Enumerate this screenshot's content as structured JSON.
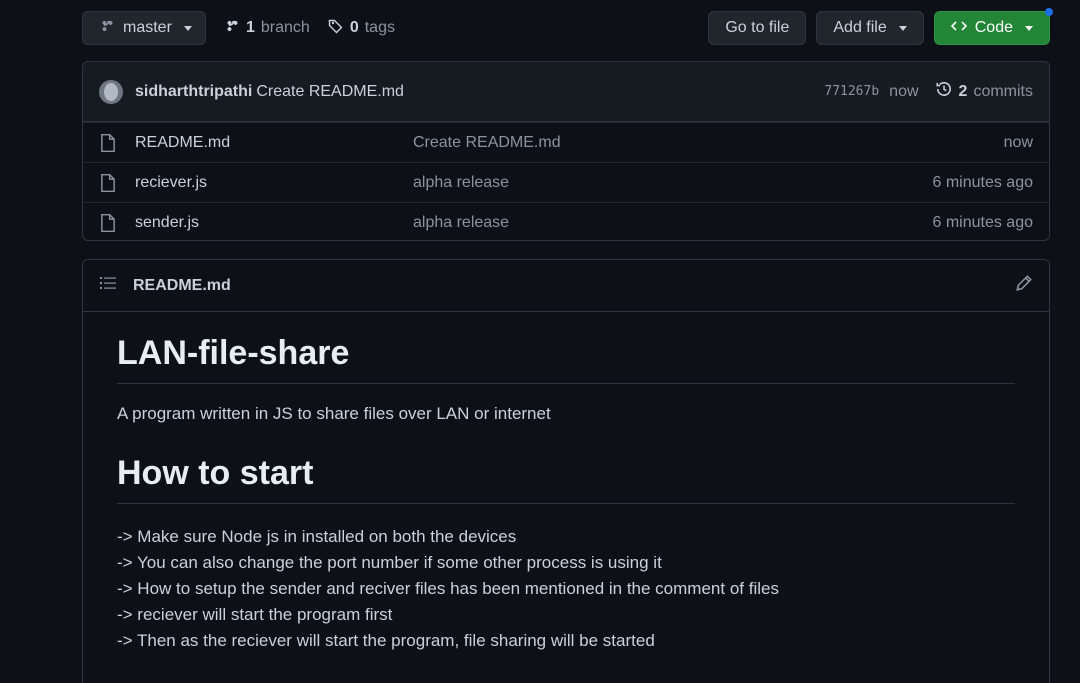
{
  "topbar": {
    "branch_label": "master",
    "branch_count": "1",
    "branch_word": "branch",
    "tag_count": "0",
    "tag_word": "tags",
    "goto_label": "Go to file",
    "add_label": "Add file",
    "code_label": "Code"
  },
  "commit": {
    "author": "sidharthtripathi",
    "message": "Create README.md",
    "sha": "771267b",
    "time": "now",
    "count": "2",
    "count_word": "commits"
  },
  "files": [
    {
      "name": "README.md",
      "commit": "Create README.md",
      "age": "now"
    },
    {
      "name": "reciever.js",
      "commit": "alpha release",
      "age": "6 minutes ago"
    },
    {
      "name": "sender.js",
      "commit": "alpha release",
      "age": "6 minutes ago"
    }
  ],
  "readme": {
    "filename": "README.md",
    "h1": "LAN-file-share",
    "intro": "A program written in JS to share files over LAN or internet",
    "h2": "How to start",
    "steps": [
      "-> Make sure Node js in installed on both the devices",
      "-> You can also change the port number if some other process is using it",
      "-> How to setup the sender and reciver files has been mentioned in the comment of files",
      "-> reciever will start the program first",
      "-> Then as the reciever will start the program, file sharing will be started"
    ]
  },
  "colors": {
    "background": "#0d1117",
    "border": "#30363d",
    "accent_green": "#238636",
    "muted": "#8b949e"
  }
}
